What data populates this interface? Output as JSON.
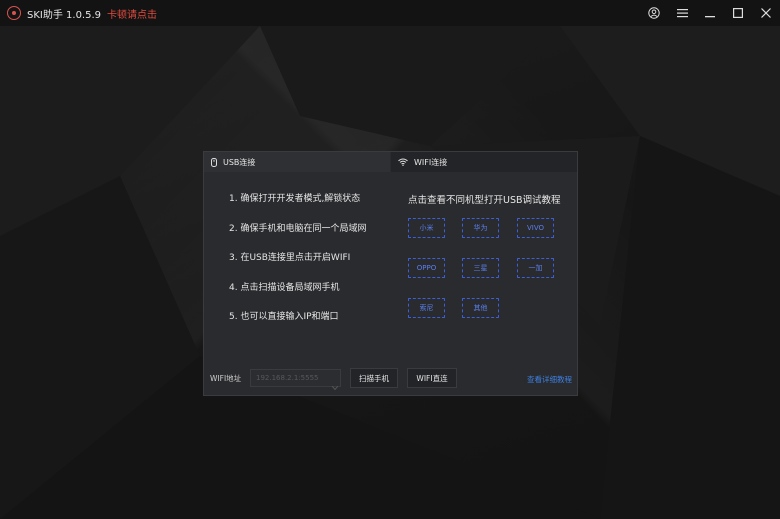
{
  "titlebar": {
    "app_title": "SKI助手 1.0.5.9",
    "link_text": "卡顿请点击",
    "icons": [
      "user-icon",
      "menu-icon",
      "minimize-icon",
      "maximize-icon",
      "close-icon"
    ]
  },
  "tabs": [
    {
      "label": "USB连接",
      "icon": "usb-icon"
    },
    {
      "label": "WIFI连接",
      "icon": "wifi-icon"
    }
  ],
  "steps": [
    "1. 确保打开开发者模式,解锁状态",
    "2. 确保手机和电脑在同一个局域网",
    "3. 在USB连接里点击开启WIFI",
    "4. 点击扫描设备局域网手机",
    "5. 也可以直接输入IP和端口"
  ],
  "brands": {
    "title": "点击查看不同机型打开USB调试教程",
    "items": [
      "小米",
      "华为",
      "VIVO",
      "OPPO",
      "三星",
      "一加",
      "索尼",
      "其他"
    ]
  },
  "bottom": {
    "wifi_label": "WIFI地址",
    "wifi_placeholder": "192.168.2.1:5555",
    "scan_button": "扫描手机",
    "connect_button": "WIFI直连",
    "detail_link": "查看详细教程"
  },
  "colors": {
    "accent_red": "#e04b3f",
    "brand_blue": "#5b7ff0",
    "link_blue": "#3d7fe0"
  }
}
